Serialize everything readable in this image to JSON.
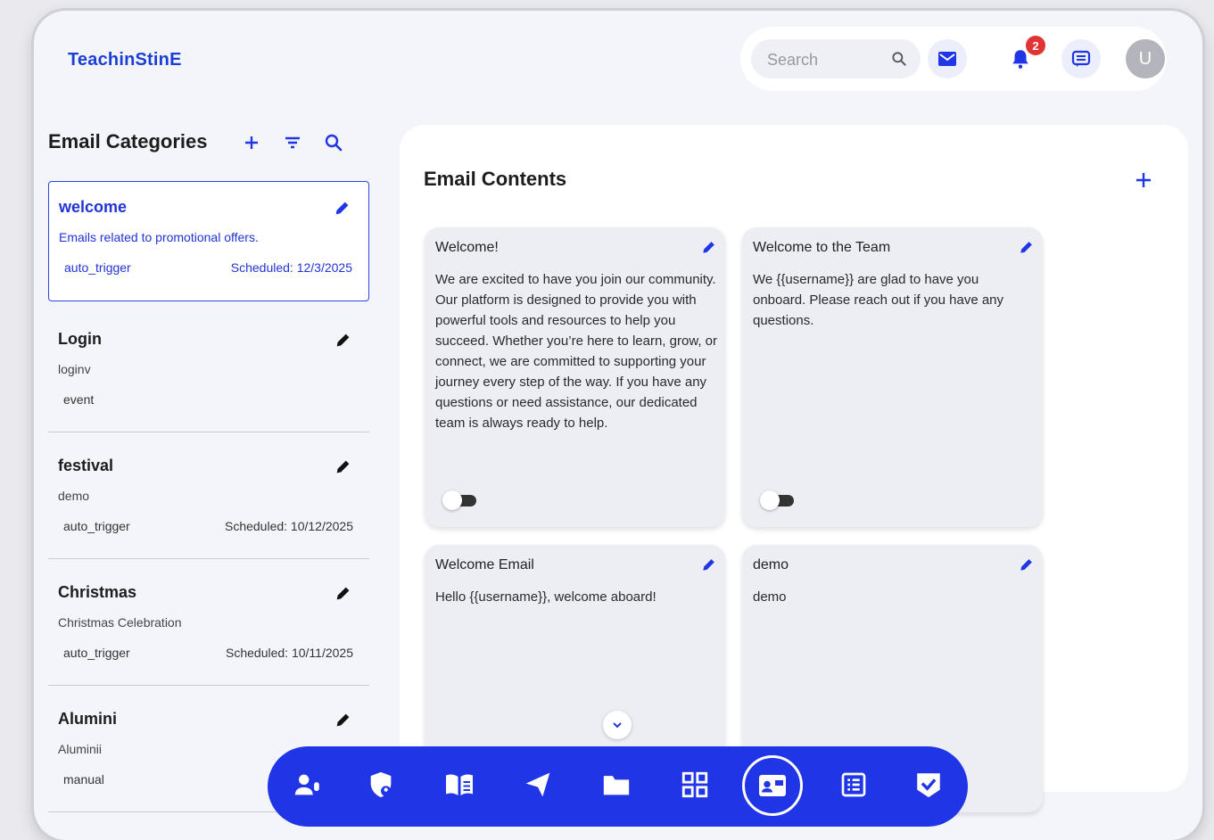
{
  "brand": {
    "logo": "TeachinStinE"
  },
  "header": {
    "search_placeholder": "Search",
    "notification_count": "2",
    "avatar_initial": "U"
  },
  "categories": {
    "title": "Email Categories",
    "items": [
      {
        "name": "welcome",
        "description": "Emails related to promotional offers.",
        "trigger": "auto_trigger",
        "scheduled": "Scheduled: 12/3/2025"
      },
      {
        "name": "Login",
        "description": "loginv",
        "trigger": "event",
        "scheduled": ""
      },
      {
        "name": "festival",
        "description": "demo",
        "trigger": "auto_trigger",
        "scheduled": "Scheduled: 10/12/2025"
      },
      {
        "name": "Christmas",
        "description": "Christmas Celebration",
        "trigger": "auto_trigger",
        "scheduled": "Scheduled: 10/11/2025"
      },
      {
        "name": "Alumini",
        "description": "Aluminii",
        "trigger": "manual",
        "scheduled": ""
      }
    ]
  },
  "contents": {
    "title": "Email Contents",
    "cards": [
      {
        "title": "Welcome!",
        "body": "We are excited to have you join our community. Our platform is designed to provide you with powerful tools and resources to help you succeed. Whether you’re here to learn, grow, or connect, we are committed to supporting your journey every step of the way. If you have any questions or need assistance, our dedicated team is always ready to help."
      },
      {
        "title": "Welcome to the Team",
        "body": "We {{username}} are glad to have you onboard. Please reach out if you have any questions."
      },
      {
        "title": "Welcome Email",
        "body": "Hello {{username}}, welcome aboard!"
      },
      {
        "title": "demo",
        "body": "demo"
      }
    ]
  },
  "dock": {
    "items": [
      "users-mic-icon",
      "shield-user-icon",
      "book-icon",
      "send-icon",
      "folder-icon",
      "grid-icon",
      "contact-card-icon",
      "list-icon",
      "check-badge-icon"
    ],
    "active": "contact-card-icon"
  },
  "colors": {
    "accent": "#1f35e6",
    "badge": "#e03434"
  }
}
